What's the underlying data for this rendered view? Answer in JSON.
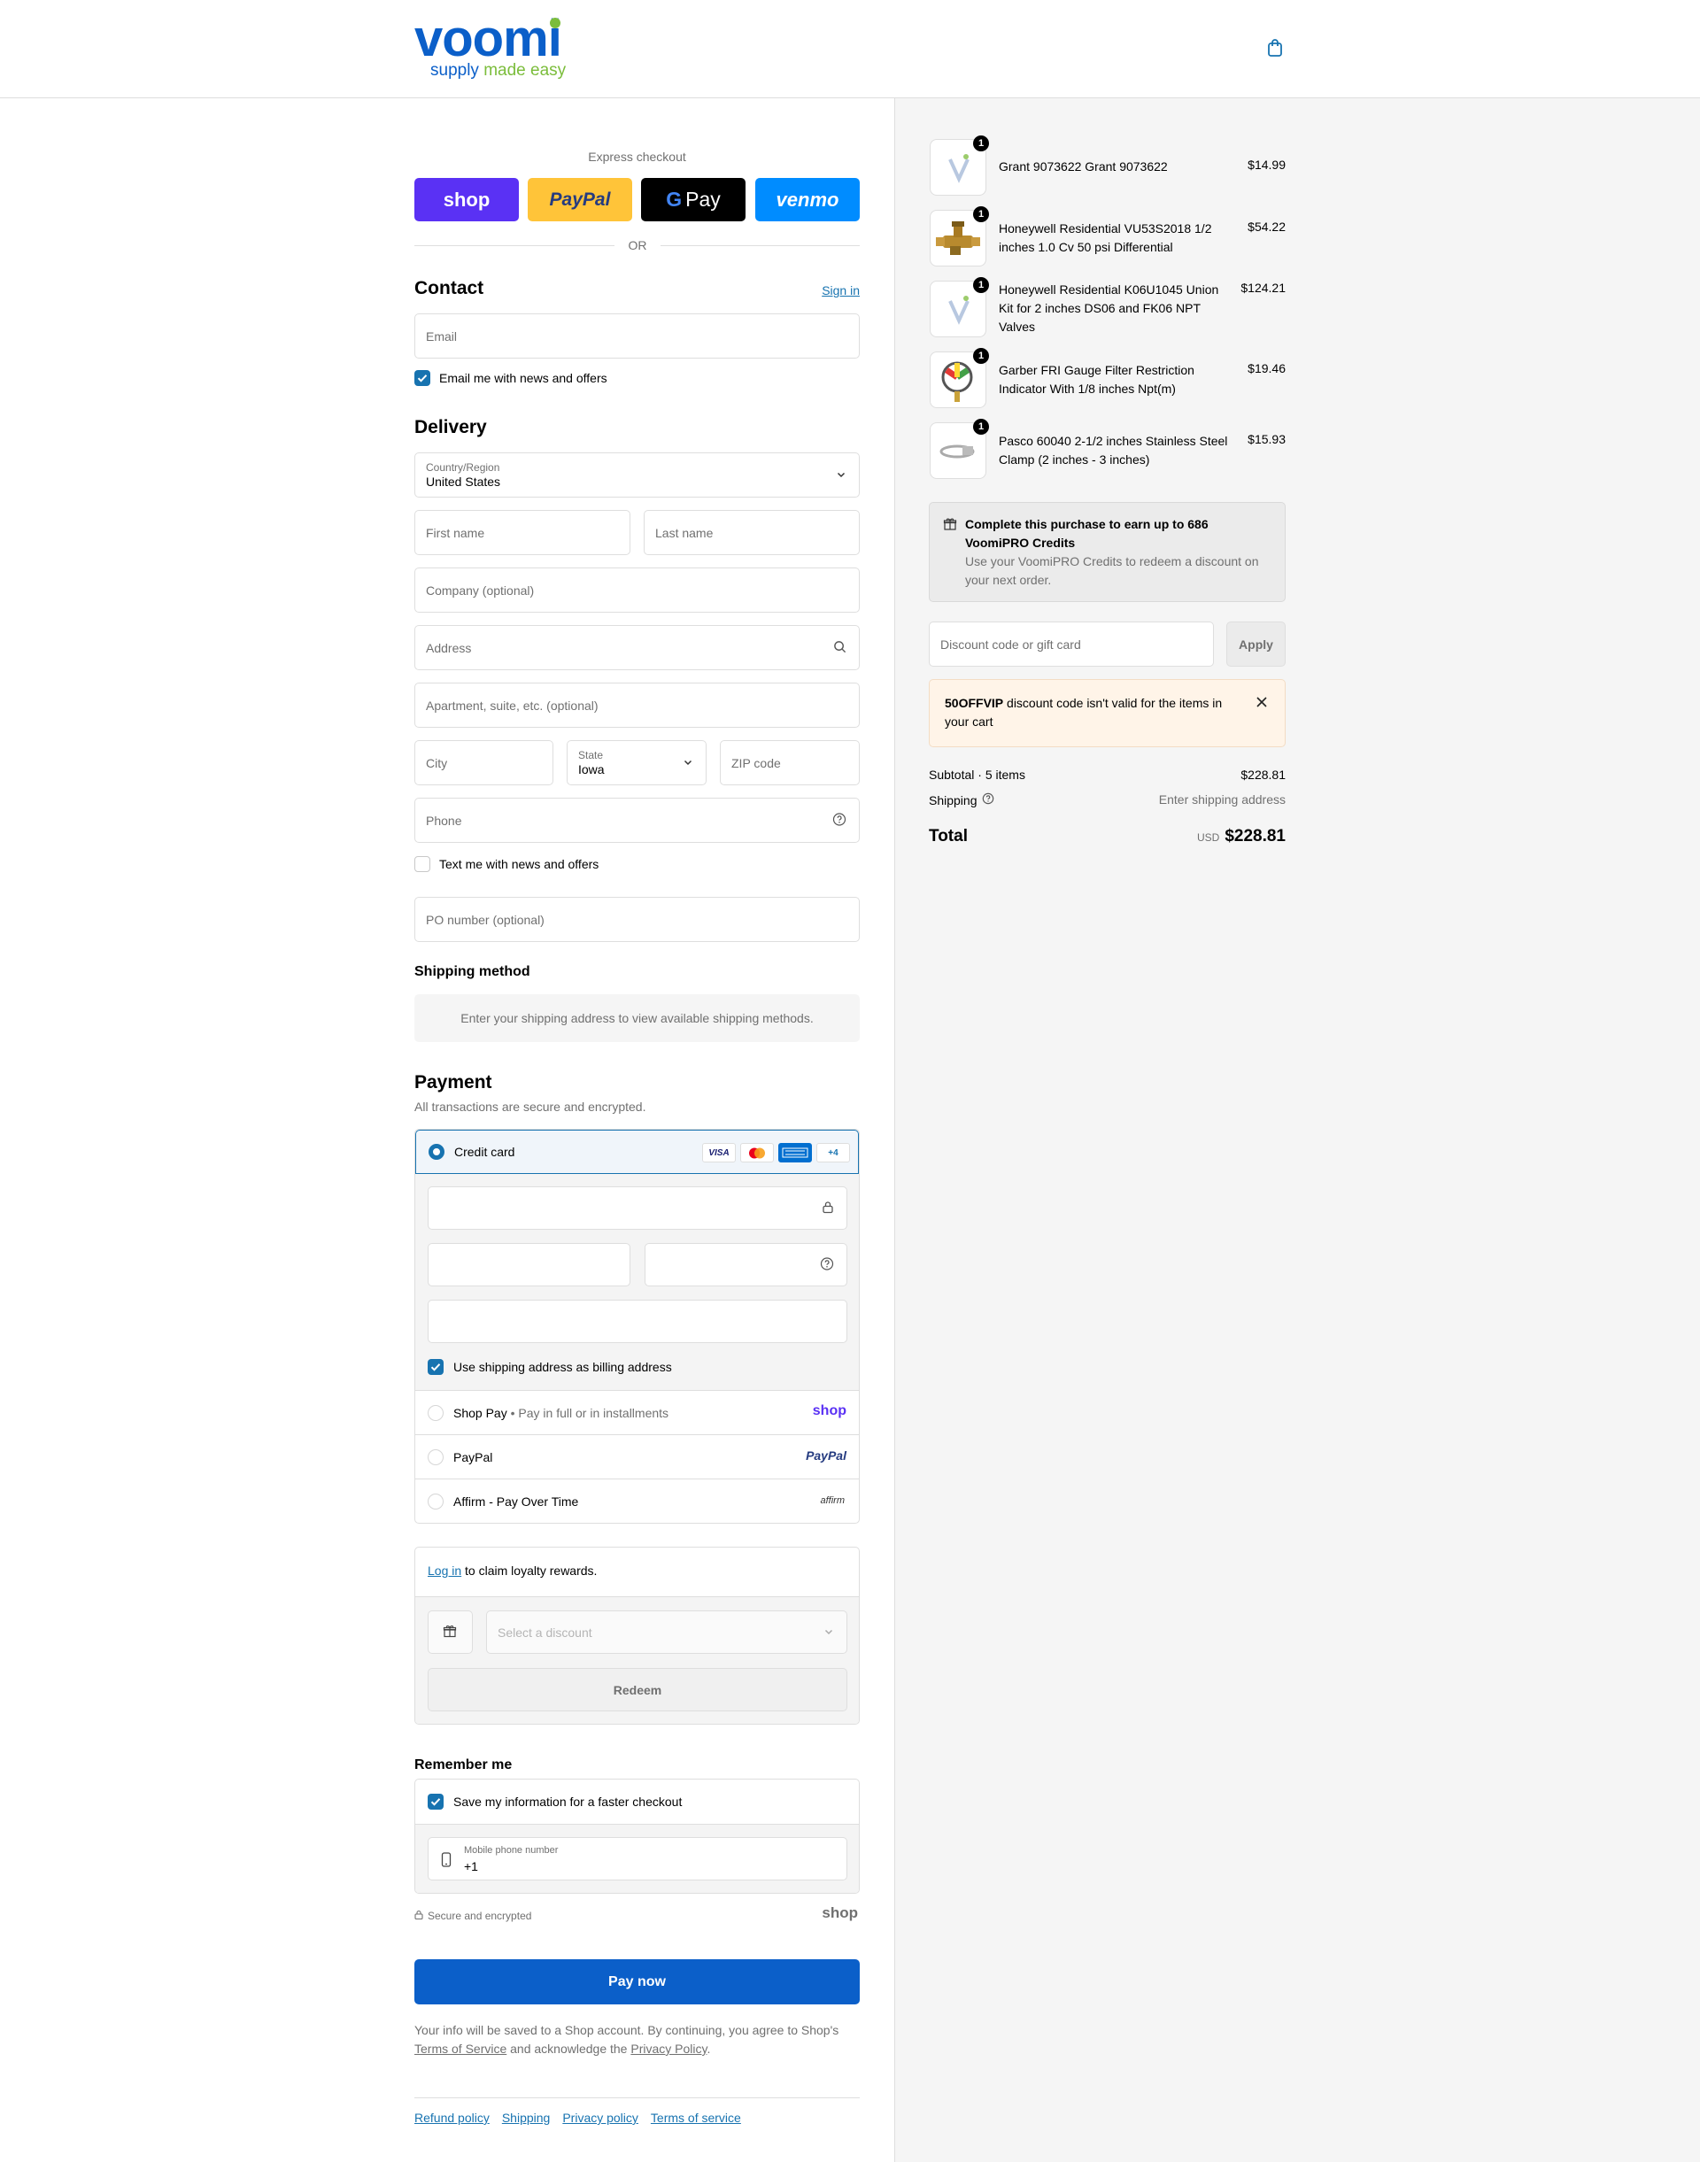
{
  "brand": {
    "word_prefix": "voom",
    "word_suffix": "i",
    "tagline_a": "supply ",
    "tagline_b": "made easy",
    "primary": "#0b5fc9",
    "accent": "#7bbd3b"
  },
  "express": {
    "title": "Express checkout",
    "or": "OR",
    "buttons": [
      {
        "label": "shop",
        "color": "#5a31f4"
      },
      {
        "label": "PayPal",
        "color": "#ffc439"
      },
      {
        "label": "Pay",
        "color": "#000000"
      },
      {
        "label": "venmo",
        "color": "#008cff"
      }
    ]
  },
  "contact": {
    "title": "Contact",
    "sign_in": "Sign in",
    "email_placeholder": "Email",
    "news_label": "Email me with news and offers"
  },
  "delivery": {
    "title": "Delivery",
    "country_label": "Country/Region",
    "country_value": "United States",
    "first_name": "First name",
    "last_name": "Last name",
    "company": "Company (optional)",
    "address": "Address",
    "apartment": "Apartment, suite, etc. (optional)",
    "city": "City",
    "state_label": "State",
    "state_value": "Iowa",
    "zip": "ZIP code",
    "phone": "Phone",
    "text_label": "Text me with news and offers",
    "po": "PO number (optional)"
  },
  "shipping_method": {
    "title": "Shipping method",
    "notice": "Enter your shipping address to view available shipping methods."
  },
  "payment": {
    "title": "Payment",
    "subtitle": "All transactions are secure and encrypted.",
    "credit_card": "Credit card",
    "card_more": "+4",
    "visa": "VISA",
    "billing_label": "Use shipping address as billing address",
    "shop_pay": "Shop Pay",
    "shop_pay_sep": "•",
    "shop_pay_note": "Pay in full or in installments",
    "shop_pay_logo": "shop",
    "paypal": "PayPal",
    "paypal_logo": "PayPal",
    "affirm": "Affirm - Pay Over Time",
    "affirm_logo": "affirm"
  },
  "loyalty": {
    "log_in": "Log in",
    "text": " to claim loyalty rewards.",
    "select_placeholder": "Select a discount",
    "redeem": "Redeem"
  },
  "remember": {
    "title": "Remember me",
    "save_label": "Save my information for a faster checkout",
    "phone_label": "Mobile phone number",
    "phone_value": "+1",
    "secure": "Secure and encrypted",
    "shop_logo": "shop"
  },
  "pay_now": "Pay now",
  "legal": {
    "pre": "Your info will be saved to a Shop account. By continuing, you agree to Shop's ",
    "tos": "Terms of Service",
    "mid": " and acknowledge the ",
    "privacy": "Privacy Policy",
    "post": "."
  },
  "footer_links": [
    "Refund policy",
    "Shipping",
    "Privacy policy",
    "Terms of service"
  ],
  "cart": {
    "items": [
      {
        "qty": "1",
        "name": "Grant 9073622 Grant 9073622",
        "price": "$14.99"
      },
      {
        "qty": "1",
        "name": "Honeywell Residential VU53S2018 1/2 inches 1.0 Cv 50 psi Differential",
        "price": "$54.22"
      },
      {
        "qty": "1",
        "name": "Honeywell Residential K06U1045 Union Kit for 2 inches DS06 and FK06 NPT Valves",
        "price": "$124.21"
      },
      {
        "qty": "1",
        "name": "Garber FRI Gauge Filter Restriction Indicator With 1/8 inches Npt(m)",
        "price": "$19.46"
      },
      {
        "qty": "1",
        "name": "Pasco 60040 2-1/2 inches Stainless Steel Clamp (2 inches - 3 inches)",
        "price": "$15.93"
      }
    ],
    "credits_title": "Complete this purchase to earn up to 686 VoomiPRO Credits",
    "credits_text": "Use your VoomiPRO Credits to redeem a discount on your next order.",
    "discount_placeholder": "Discount code or gift card",
    "apply": "Apply",
    "error_code": "50OFFVIP",
    "error_text": " discount code isn't valid for the items in your cart",
    "subtotal_label": "Subtotal · 5 items",
    "subtotal_value": "$228.81",
    "shipping_label": "Shipping",
    "shipping_value": "Enter shipping address",
    "total_label": "Total",
    "currency": "USD",
    "total_value": "$228.81"
  }
}
